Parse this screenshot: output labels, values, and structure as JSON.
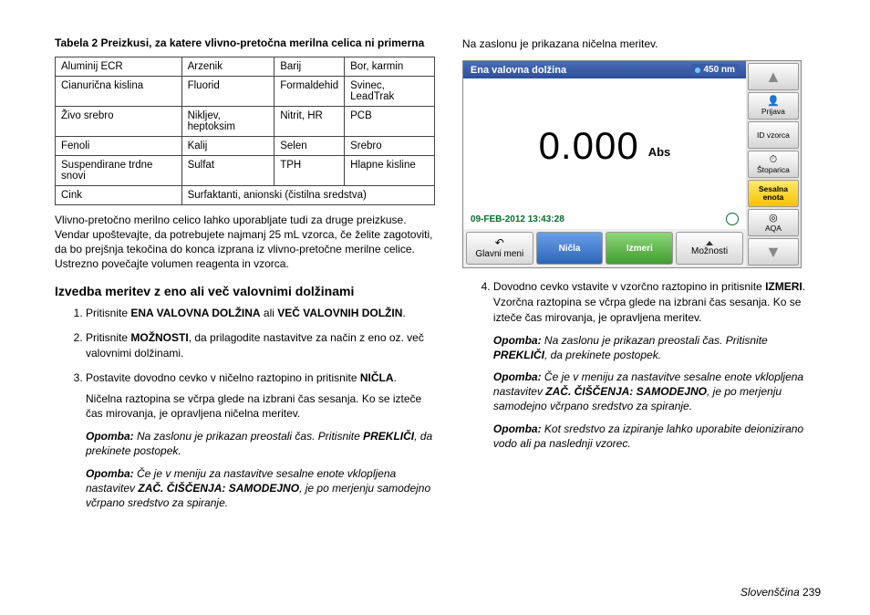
{
  "left": {
    "table_caption": "Tabela 2 Preizkusi, za katere vlivno-pretočna merilna celica ni primerna",
    "rows": [
      [
        "Aluminij ECR",
        "Arzenik",
        "Barij",
        "Bor, karmin"
      ],
      [
        "Cianurična kislina",
        "Fluorid",
        "Formaldehid",
        "Svinec, LeadTrak"
      ],
      [
        "Živo srebro",
        "Nikljev, heptoksim",
        "Nitrit, HR",
        "PCB"
      ],
      [
        "Fenoli",
        "Kalij",
        "Selen",
        "Srebro"
      ],
      [
        "Suspendirane trdne snovi",
        "Sulfat",
        "TPH",
        "Hlapne kisline"
      ],
      [
        "Cink",
        "Surfaktanti, anionski (čistilna sredstva)",
        "",
        ""
      ]
    ],
    "para1": "Vlivno-pretočno merilno celico lahko uporabljate tudi za druge preizkuse. Vendar upoštevajte, da potrebujete najmanj 25 mL vzorca, če želite zagotoviti, da bo prejšnja tekočina do konca izprana iz vlivno-pretočne merilne celice. Ustrezno povečajte volumen reagenta in vzorca.",
    "heading": "Izvedba meritev z eno ali več valovnimi dolžinami",
    "step1_a": "Pritisnite ",
    "step1_b": "ENA VALOVNA DOLŽINA",
    "step1_c": " ali ",
    "step1_d": "VEČ VALOVNIH DOLŽIN",
    "step1_e": ".",
    "step2_a": "Pritisnite ",
    "step2_b": "MOŽNOSTI",
    "step2_c": ", da prilagodite nastavitve za način z eno oz. več valovnimi dolžinami.",
    "step3_a": "Postavite dovodno cevko v ničelno raztopino in pritisnite ",
    "step3_b": "NIČLA",
    "step3_c": ".",
    "step3_sub": "Ničelna raztopina se včrpa glede na izbrani čas sesanja. Ko se izteče čas mirovanja, je opravljena ničelna meritev.",
    "step3_note1_a": "Opomba:",
    "step3_note1_b": " Na zaslonu je prikazan preostali čas. Pritisnite ",
    "step3_note1_c": "PREKLIČI",
    "step3_note1_d": ", da prekinete postopek.",
    "step3_note2_a": "Opomba:",
    "step3_note2_b": " Če je v meniju za nastavitve sesalne enote vklopljena nastavitev ",
    "step3_note2_c": "ZAČ. ČIŠČENJA: SAMODEJNO",
    "step3_note2_d": ", je po merjenju samodejno včrpano sredstvo za spiranje."
  },
  "right": {
    "intro": "Na zaslonu je prikazana ničelna meritev.",
    "screen": {
      "title": "Ena valovna dolžina",
      "wavelength": "450 nm",
      "value": "0.000",
      "unit": "Abs",
      "timestamp": "09-FEB-2012  13:43:28",
      "btn_main": "Glavni meni",
      "btn_zero": "Ničla",
      "btn_measure": "Izmeri",
      "btn_options": "Možnosti",
      "side_login": "Prijava",
      "side_sample": "ID vzorca",
      "side_timer": "Štoparica",
      "side_sip": "Sesalna enota",
      "side_aqa": "AQA"
    },
    "step4_a": "Dovodno cevko vstavite v vzorčno raztopino in pritisnite ",
    "step4_b": "IZMERI",
    "step4_c": ".",
    "step4_sub": "Vzorčna raztopina se včrpa glede na izbrani čas sesanja. Ko se izteče čas mirovanja, je opravljena meritev.",
    "note1_a": "Opomba:",
    "note1_b": " Na zaslonu je prikazan preostali čas. Pritisnite ",
    "note1_c": "PREKLIČI",
    "note1_d": ", da prekinete postopek.",
    "note2_a": "Opomba:",
    "note2_b": " Če je v meniju za nastavitve sesalne enote vklopljena nastavitev ",
    "note2_c": "ZAČ. ČIŠČENJA: SAMODEJNO",
    "note2_d": ", je po merjenju samodejno včrpano sredstvo za spiranje.",
    "note3_a": "Opomba:",
    "note3_b": " Kot sredstvo za izpiranje lahko uporabite deionizirano vodo ali pa naslednji vzorec."
  },
  "footer": {
    "lang": "Slovenščina",
    "page": "239"
  }
}
